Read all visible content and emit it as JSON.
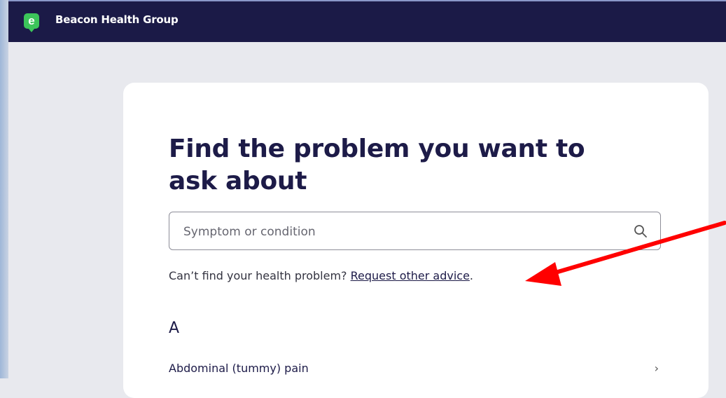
{
  "app": {
    "logo_letter": "e",
    "title": "Beacon Health Group"
  },
  "main": {
    "title": "Find the problem you want to ask about",
    "search": {
      "placeholder": "Symptom or condition",
      "value": ""
    },
    "help": {
      "prefix": "Can’t find your health problem? ",
      "link": "Request other advice",
      "suffix": "."
    },
    "section_letter": "A",
    "items": [
      {
        "label": "Abdominal (tummy) pain",
        "chevron": "›"
      }
    ]
  },
  "icons": {
    "search": "search-icon",
    "chevron": "chevron-right-icon",
    "annotation": "red-arrow-icon"
  },
  "colors": {
    "topbar": "#1b1a47",
    "brand_green": "#3cc55a",
    "heading": "#1d1b48",
    "annotation_arrow": "#ff0000"
  }
}
